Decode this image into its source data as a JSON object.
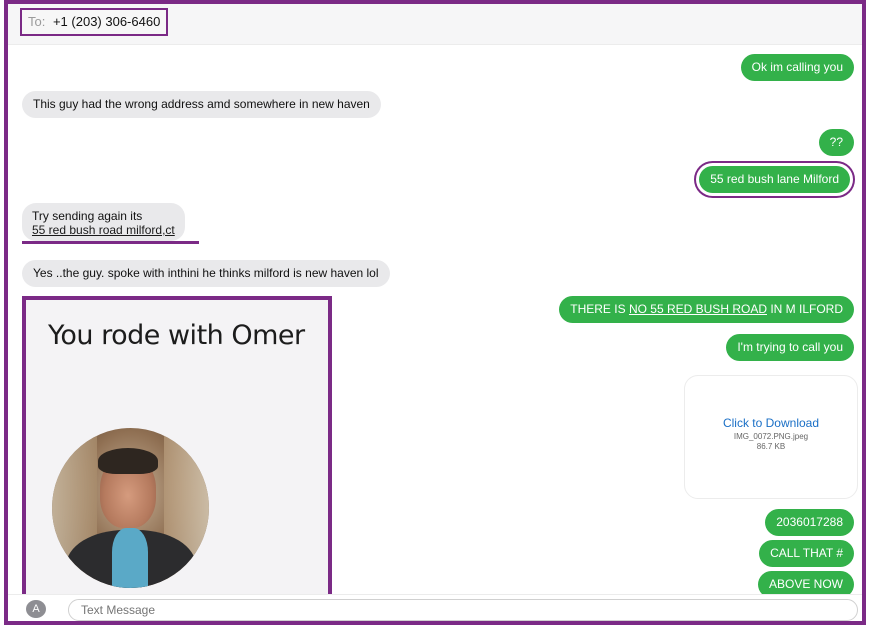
{
  "header": {
    "to_label": "To:",
    "recipient": "+1 (203) 306-6460"
  },
  "messages": {
    "m1": "Ok im calling you",
    "m2": "This guy had the wrong address amd somewhere in new haven",
    "m3": "??",
    "m4": "55 red bush lane Milford",
    "m5_line1": "Try sending again its",
    "m5_line2": "55 red bush road milford,ct",
    "m6": "Yes ..the guy. spoke with inthini he thinks milford is new haven lol",
    "m7_pre": "THERE IS ",
    "m7_link": "NO 55 RED BUSH ROAD",
    "m7_post": " IN M ILFORD",
    "m8": "I'm trying to call you",
    "m9": "2036017288",
    "m10": "CALL THAT #",
    "m11": "ABOVE NOW"
  },
  "ride_card": {
    "title": "You rode with Omer"
  },
  "attachment": {
    "link": "Click to Download",
    "filename": "IMG_0072.PNG.jpeg",
    "size": "86.7 KB"
  },
  "compose": {
    "apps_icon": "A",
    "placeholder": "Text Message"
  },
  "colors": {
    "sent": "#33b14a",
    "received": "#e9e9eb",
    "highlight": "#7b2a86",
    "link": "#1a6fc6"
  }
}
